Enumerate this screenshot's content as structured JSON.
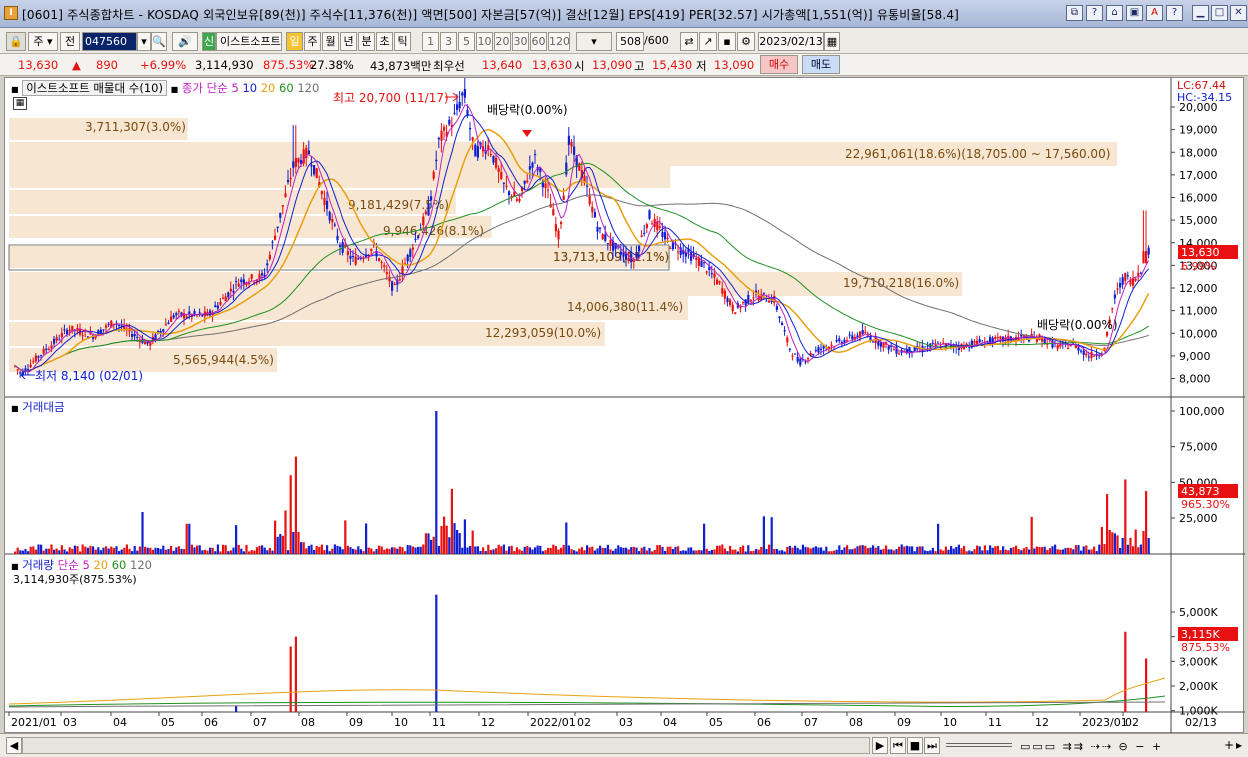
{
  "window": {
    "app_icon": "I",
    "title": "[0601] 주식종합차트 - KOSDAQ 외국인보유[89(천)] 주식수[11,376(천)] 액면[500] 자본금[57(억)] 결산[12월] EPS[419] PER[32.57] 시가총액[1,551(억)] 유통비율[58.4]",
    "buttons": [
      "restore-icon",
      "help-icon",
      "link-icon",
      "web-icon",
      "font-icon",
      "question-icon",
      "minimize-icon",
      "maximize-icon",
      "close-icon"
    ]
  },
  "toolbar": {
    "period_select": "주",
    "prev_label": "전",
    "code": "047560",
    "stock_badge": "신",
    "stock_name": "이스트소프트",
    "period_tabs": [
      "일",
      "주",
      "월",
      "년",
      "분",
      "초",
      "틱"
    ],
    "active_period": "일",
    "interval_tabs": [
      "1",
      "3",
      "5",
      "10",
      "20",
      "30",
      "60",
      "120"
    ],
    "count": "508",
    "count_total": "/600",
    "date": "2023/02/13"
  },
  "quote": {
    "price": "13,630",
    "arrow": "▲",
    "change": "890",
    "change_pct": "+6.99%",
    "volume": "3,114,930",
    "volume_ratio": "875.53%",
    "turnover": "27.38%",
    "amount": "43,873백만",
    "best_label": "최우선",
    "ask": "13,640",
    "bid": "13,630",
    "open_label": "시",
    "open": "13,090",
    "high_label": "고",
    "high": "15,430",
    "low_label": "저",
    "low": "13,090",
    "buy_label": "매수",
    "sell_label": "매도"
  },
  "price_panel": {
    "legend_title": "이스트소프트 매물대 수(10)",
    "legend_ma_label": "종가 단순",
    "ma_periods": [
      "5",
      "10",
      "20",
      "60",
      "120"
    ],
    "lc": "LC:67.44",
    "hc": "HC:-34.15",
    "current_tag": "13,630",
    "current_pct": "6.99%",
    "high_note": "최고 20,700 (11/17)",
    "low_note": "최저 8,140 (02/01)",
    "dividend_1": "배당락(0.00%)",
    "dividend_2": "배당락(0.00%)",
    "y_ticks": [
      "20,000",
      "19,000",
      "18,000",
      "17,000",
      "16,000",
      "15,000",
      "14,000",
      "13,000",
      "12,000",
      "11,000",
      "10,000",
      "9,000",
      "8,000"
    ],
    "volume_profile": [
      {
        "label": "22,961,061(18.6%)(18,705.00 ~ 17,560.00)",
        "pct": 18.6
      },
      {
        "label": "3,711,307(3.0%)",
        "pct": 3.0
      },
      {
        "label": "13,713,109(11.1%)",
        "pct": 11.1
      },
      {
        "label": "9,181,429(7.5%)",
        "pct": 7.5
      },
      {
        "label": "9,946,426(8.1%)",
        "pct": 8.1
      },
      {
        "label": "13,713,109(11.1%)",
        "pct": 11.1
      },
      {
        "label": "19,710,218(16.0%)",
        "pct": 16.0
      },
      {
        "label": "14,006,380(11.4%)",
        "pct": 11.4
      },
      {
        "label": "12,293,059(10.0%)",
        "pct": 10.0
      },
      {
        "label": "5,565,944(4.5%)",
        "pct": 4.5
      }
    ]
  },
  "amount_panel": {
    "legend": "거래대금",
    "y_ticks": [
      "100,000",
      "75,000",
      "50,000",
      "25,000"
    ],
    "current_tag": "43,873",
    "current_pct": "965.30%"
  },
  "volume_panel": {
    "legend_title": "거래량",
    "legend_ma_label": "단순",
    "ma_periods": [
      "5",
      "20",
      "60",
      "120"
    ],
    "info": "3,114,930주(875.53%)",
    "y_ticks": [
      "5,000K",
      "4,000K",
      "3,000K",
      "2,000K",
      "1,000K"
    ],
    "current_tag": "3,115K",
    "current_pct": "875.53%"
  },
  "x_axis": {
    "labels": [
      "2021/01",
      "03",
      "04",
      "05",
      "06",
      "07",
      "08",
      "09",
      "10",
      "11",
      "12",
      "2022/01",
      "02",
      "03",
      "04",
      "05",
      "06",
      "07",
      "08",
      "09",
      "10",
      "11",
      "12",
      "2023/01",
      "02"
    ],
    "right_label": "02/13"
  },
  "colors": {
    "up": "#e81010",
    "down": "#1020d0",
    "profile": "#f6e6d2",
    "ma5": "#c020c0",
    "ma20": "#e8a010",
    "ma60": "#209020",
    "ma120": "#707070"
  }
}
